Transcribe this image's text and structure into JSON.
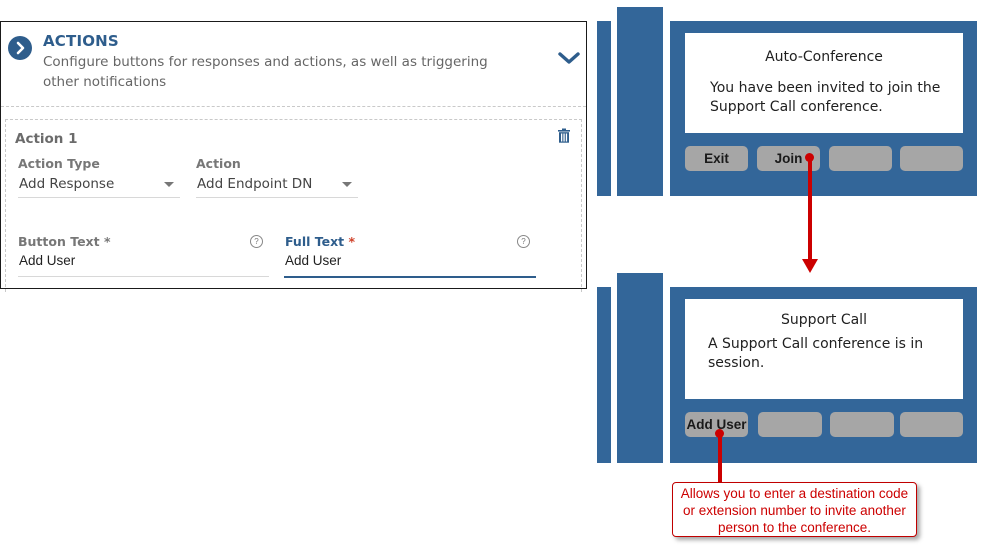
{
  "panel": {
    "title": "ACTIONS",
    "description": "Configure buttons for responses and actions, as well as triggering other notifications",
    "icons": {
      "header": "chevron-right-circle-icon",
      "collapse": "chevron-down-icon"
    },
    "action_card": {
      "title": "Action 1",
      "delete_icon": "trash-icon",
      "action_type": {
        "label": "Action Type",
        "value": "Add Response"
      },
      "action": {
        "label": "Action",
        "value": "Add Endpoint DN"
      },
      "button_text": {
        "label": "Button Text",
        "required_mark": "*",
        "value": "Add User",
        "help_icon": "?"
      },
      "full_text": {
        "label": "Full Text",
        "required_mark": "*",
        "value": "Add User",
        "help_icon": "?"
      }
    }
  },
  "phone_before": {
    "screen_title": "Auto-Conference",
    "screen_body": "You have been invited to join the Support Call conference.",
    "softkeys": [
      "Exit",
      "Join",
      "",
      ""
    ]
  },
  "phone_after": {
    "screen_title": "Support Call",
    "screen_body": "A Support Call conference is in session.",
    "softkeys": [
      "Add User",
      "",
      "",
      ""
    ]
  },
  "callout": {
    "text": "Allows you to enter a destination code or extension number to invite another person to the conference."
  },
  "colors": {
    "brand_blue": "#2e5d8c",
    "phone_blue": "#336699",
    "softkey_gray": "#a6a6a6",
    "annotation_red": "#cc0000",
    "required_red": "#d0432b"
  }
}
